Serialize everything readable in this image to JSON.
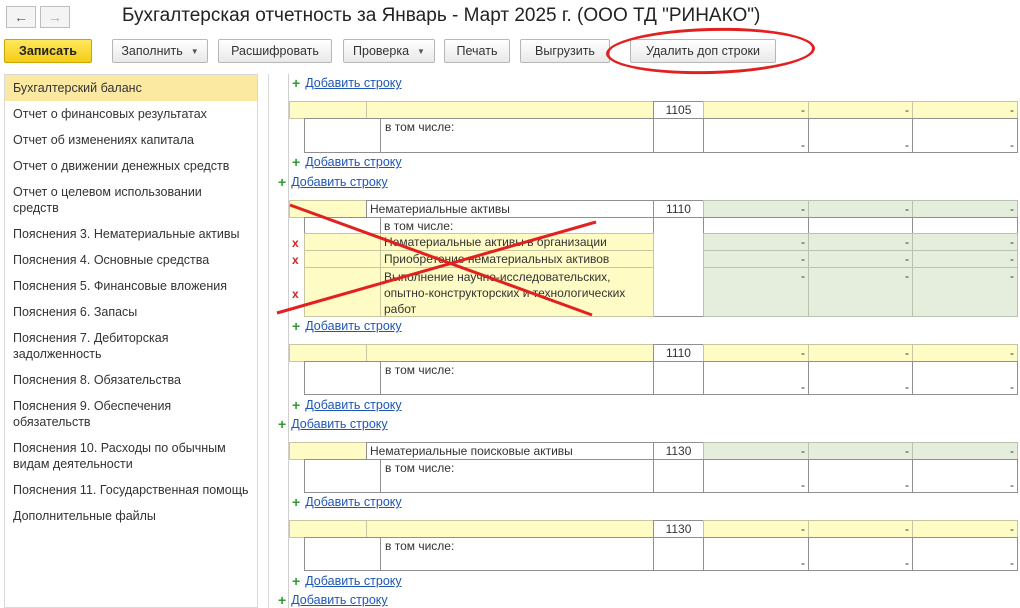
{
  "window": {
    "title": "Бухгалтерская отчетность за Январь - Март 2025 г. (ООО ТД \"РИНАКО\")",
    "back_icon": "arrow-left-icon",
    "forward_icon": "arrow-right-icon"
  },
  "toolbar": {
    "save": "Записать",
    "fill": "Заполнить",
    "decode": "Расшифровать",
    "check": "Проверка",
    "print": "Печать",
    "export": "Выгрузить",
    "delete_extra": "Удалить доп строки",
    "annotation_color": "#e32020"
  },
  "sidebar": {
    "items": [
      "Бухгалтерский баланс",
      "Отчет о финансовых результатах",
      "Отчет об изменениях капитала",
      "Отчет о движении денежных средств",
      "Отчет о целевом использовании средств",
      "Пояснения 3. Нематериальные активы",
      "Пояснения 4. Основные средства",
      "Пояснения 5. Финансовые вложения",
      "Пояснения 6. Запасы",
      "Пояснения 7. Дебиторская задолженность",
      "Пояснения 8. Обязательства",
      "Пояснения 9. Обеспечения обязательств",
      "Пояснения 10. Расходы по обычным видам деятельности",
      "Пояснения 11. Государственная помощь",
      "Дополнительные файлы"
    ]
  },
  "report": {
    "add_row": "Добавить строку",
    "including": "в том числе:",
    "dash": "-",
    "delete_mark": "x",
    "codes": [
      "1105",
      "1110",
      "1110",
      "1130",
      "1130"
    ],
    "intangible_assets": "Нематериальные активы",
    "sub_items": [
      "Нематериальные активы в организации",
      "Приобретение нематериальных активов",
      "Выполнение научно-исследовательских, опытно-конструкторских и технологических работ"
    ],
    "search_assets": "Нематериальные поисковые активы"
  }
}
